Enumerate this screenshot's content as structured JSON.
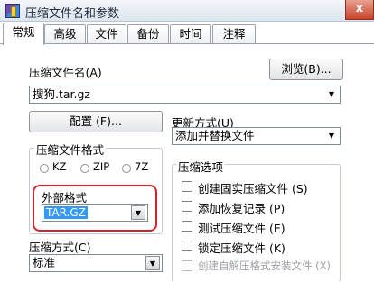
{
  "window": {
    "title": "压缩文件名和参数",
    "close_glyph": "x"
  },
  "tabs": [
    {
      "label": "常规"
    },
    {
      "label": "高级"
    },
    {
      "label": "文件"
    },
    {
      "label": "备份"
    },
    {
      "label": "时间"
    },
    {
      "label": "注释"
    }
  ],
  "archive_name": {
    "label": "压缩文件名(A)",
    "browse_label": "浏览(B)...",
    "value": "搜狗.tar.gz"
  },
  "config_button": "配置 (F)...",
  "update_mode": {
    "label": "更新方式(U)",
    "value": "添加并替换文件"
  },
  "format_group": {
    "title": "压缩文件格式",
    "options": [
      "KZ",
      "ZIP",
      "7Z"
    ],
    "external_label": "外部格式",
    "external_value": "TAR.GZ"
  },
  "options_group": {
    "title": "压缩选项",
    "items": [
      {
        "label": "创建固实压缩文件 (S)",
        "enabled": true
      },
      {
        "label": "添加恢复记录 (P)",
        "enabled": true
      },
      {
        "label": "测试压缩文件 (E)",
        "enabled": true
      },
      {
        "label": "锁定压缩文件 (K)",
        "enabled": true
      },
      {
        "label": "创建自解压格式安装文件 (X)",
        "enabled": false
      }
    ]
  },
  "method": {
    "label": "压缩方式(C)",
    "value": "标准"
  },
  "icons": {
    "dropdown": "chevron-down-icon"
  },
  "colors": {
    "highlight_ring": "#d6232b",
    "selection": "#3399ff"
  }
}
